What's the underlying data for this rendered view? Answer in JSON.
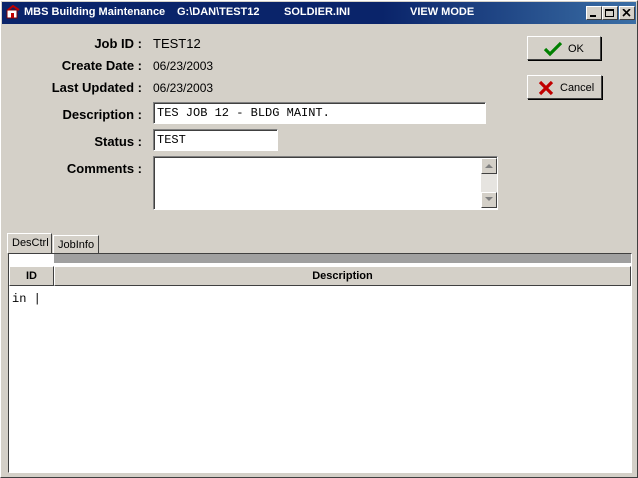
{
  "window": {
    "title_app": "MBS Building Maintenance",
    "title_path": "G:\\DAN\\TEST12",
    "title_ini": "SOLDIER.INI",
    "title_mode": "VIEW MODE"
  },
  "form": {
    "job_id_label": "Job ID :",
    "job_id_value": "TEST12",
    "create_date_label": "Create Date :",
    "create_date_value": "06/23/2003",
    "last_updated_label": "Last Updated :",
    "last_updated_value": "06/23/2003",
    "description_label": "Description :",
    "description_value": "TES JOB 12 - BLDG MAINT.",
    "status_label": "Status :",
    "status_value": "TEST",
    "comments_label": "Comments :",
    "comments_value": ""
  },
  "buttons": {
    "ok_label": "OK",
    "cancel_label": "Cancel"
  },
  "tabs": [
    {
      "label": "DesCtrl",
      "active": true
    },
    {
      "label": "JobInfo",
      "active": false
    }
  ],
  "grid": {
    "columns": [
      "ID",
      "Description"
    ],
    "rows": [
      {
        "text": "in |"
      }
    ]
  },
  "colors": {
    "titlebar": "#0a246a",
    "face": "#d4d0c8",
    "ok_check": "#008000",
    "cancel_x": "#c00000"
  }
}
